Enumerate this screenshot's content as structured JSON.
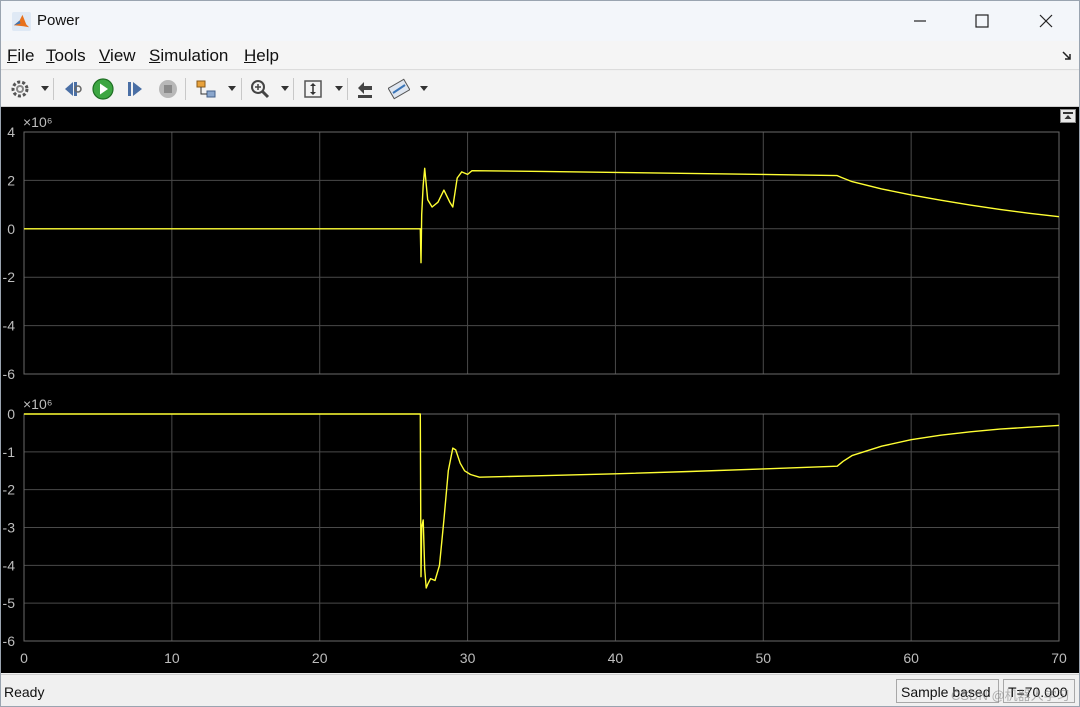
{
  "window": {
    "title": "Power"
  },
  "menu": [
    {
      "label": "File",
      "u": "F",
      "rest": "ile"
    },
    {
      "label": "Tools",
      "u": "T",
      "rest": "ools"
    },
    {
      "label": "View",
      "u": "V",
      "rest": "iew"
    },
    {
      "label": "Simulation",
      "u": "S",
      "rest": "imulation"
    },
    {
      "label": "Help",
      "u": "H",
      "rest": "elp"
    }
  ],
  "toolbar_icons": [
    "gear-icon",
    "step-back-icon",
    "run-icon",
    "step-forward-icon",
    "stop-icon",
    "signal-select-icon",
    "zoom-icon",
    "fit-axes-icon",
    "highlight-block-icon",
    "style-icon"
  ],
  "status": {
    "text": "Ready",
    "sample_mode": "Sample based",
    "time": "T=70.000",
    "watermark": "CSDN @机器人学习"
  },
  "colors": {
    "trace": "#ffff33",
    "grid": "#4a4a4a",
    "axis_text": "#bdbdbd",
    "background": "#000000"
  },
  "chart_data": [
    {
      "type": "line",
      "exponent_label": "×10⁶",
      "xlim": [
        0,
        70
      ],
      "ylim": [
        -6,
        4
      ],
      "yticks": [
        -6,
        -4,
        -2,
        0,
        2,
        4
      ],
      "grid": true,
      "series": [
        {
          "x": [
            0,
            26.8,
            26.85,
            26.9,
            27.0,
            27.1,
            27.3,
            27.6,
            28.0,
            28.4,
            28.8,
            29.0,
            29.3,
            29.6,
            30.0,
            30.3,
            35,
            40,
            45,
            50,
            55,
            55.3,
            56,
            58,
            60,
            62,
            64,
            66,
            68,
            70
          ],
          "y": [
            0,
            0,
            -1.4,
            0.6,
            1.8,
            2.5,
            1.2,
            0.9,
            1.1,
            1.6,
            1.1,
            0.9,
            2.1,
            2.35,
            2.25,
            2.4,
            2.37,
            2.33,
            2.29,
            2.25,
            2.2,
            2.12,
            1.95,
            1.65,
            1.4,
            1.18,
            0.98,
            0.8,
            0.64,
            0.5
          ]
        }
      ]
    },
    {
      "type": "line",
      "exponent_label": "×10⁶",
      "xlim": [
        0,
        70
      ],
      "ylim": [
        -6,
        0
      ],
      "yticks": [
        -6,
        -5,
        -4,
        -3,
        -2,
        -1,
        0
      ],
      "xticks": [
        0,
        10,
        20,
        30,
        40,
        50,
        60,
        70
      ],
      "grid": true,
      "series": [
        {
          "x": [
            0,
            26.8,
            26.85,
            26.9,
            27.0,
            27.1,
            27.2,
            27.3,
            27.5,
            27.8,
            28.1,
            28.4,
            28.7,
            29.0,
            29.2,
            29.5,
            29.8,
            30.2,
            30.8,
            35,
            40,
            45,
            50,
            55,
            55.4,
            56,
            58,
            60,
            62,
            64,
            66,
            68,
            70
          ],
          "y": [
            0,
            0,
            -4.3,
            -3.0,
            -2.8,
            -4.1,
            -4.6,
            -4.5,
            -4.35,
            -4.4,
            -4.0,
            -2.8,
            -1.5,
            -0.9,
            -0.95,
            -1.3,
            -1.5,
            -1.6,
            -1.67,
            -1.63,
            -1.58,
            -1.52,
            -1.45,
            -1.38,
            -1.25,
            -1.1,
            -0.85,
            -0.68,
            -0.56,
            -0.47,
            -0.4,
            -0.35,
            -0.3
          ]
        }
      ]
    }
  ]
}
